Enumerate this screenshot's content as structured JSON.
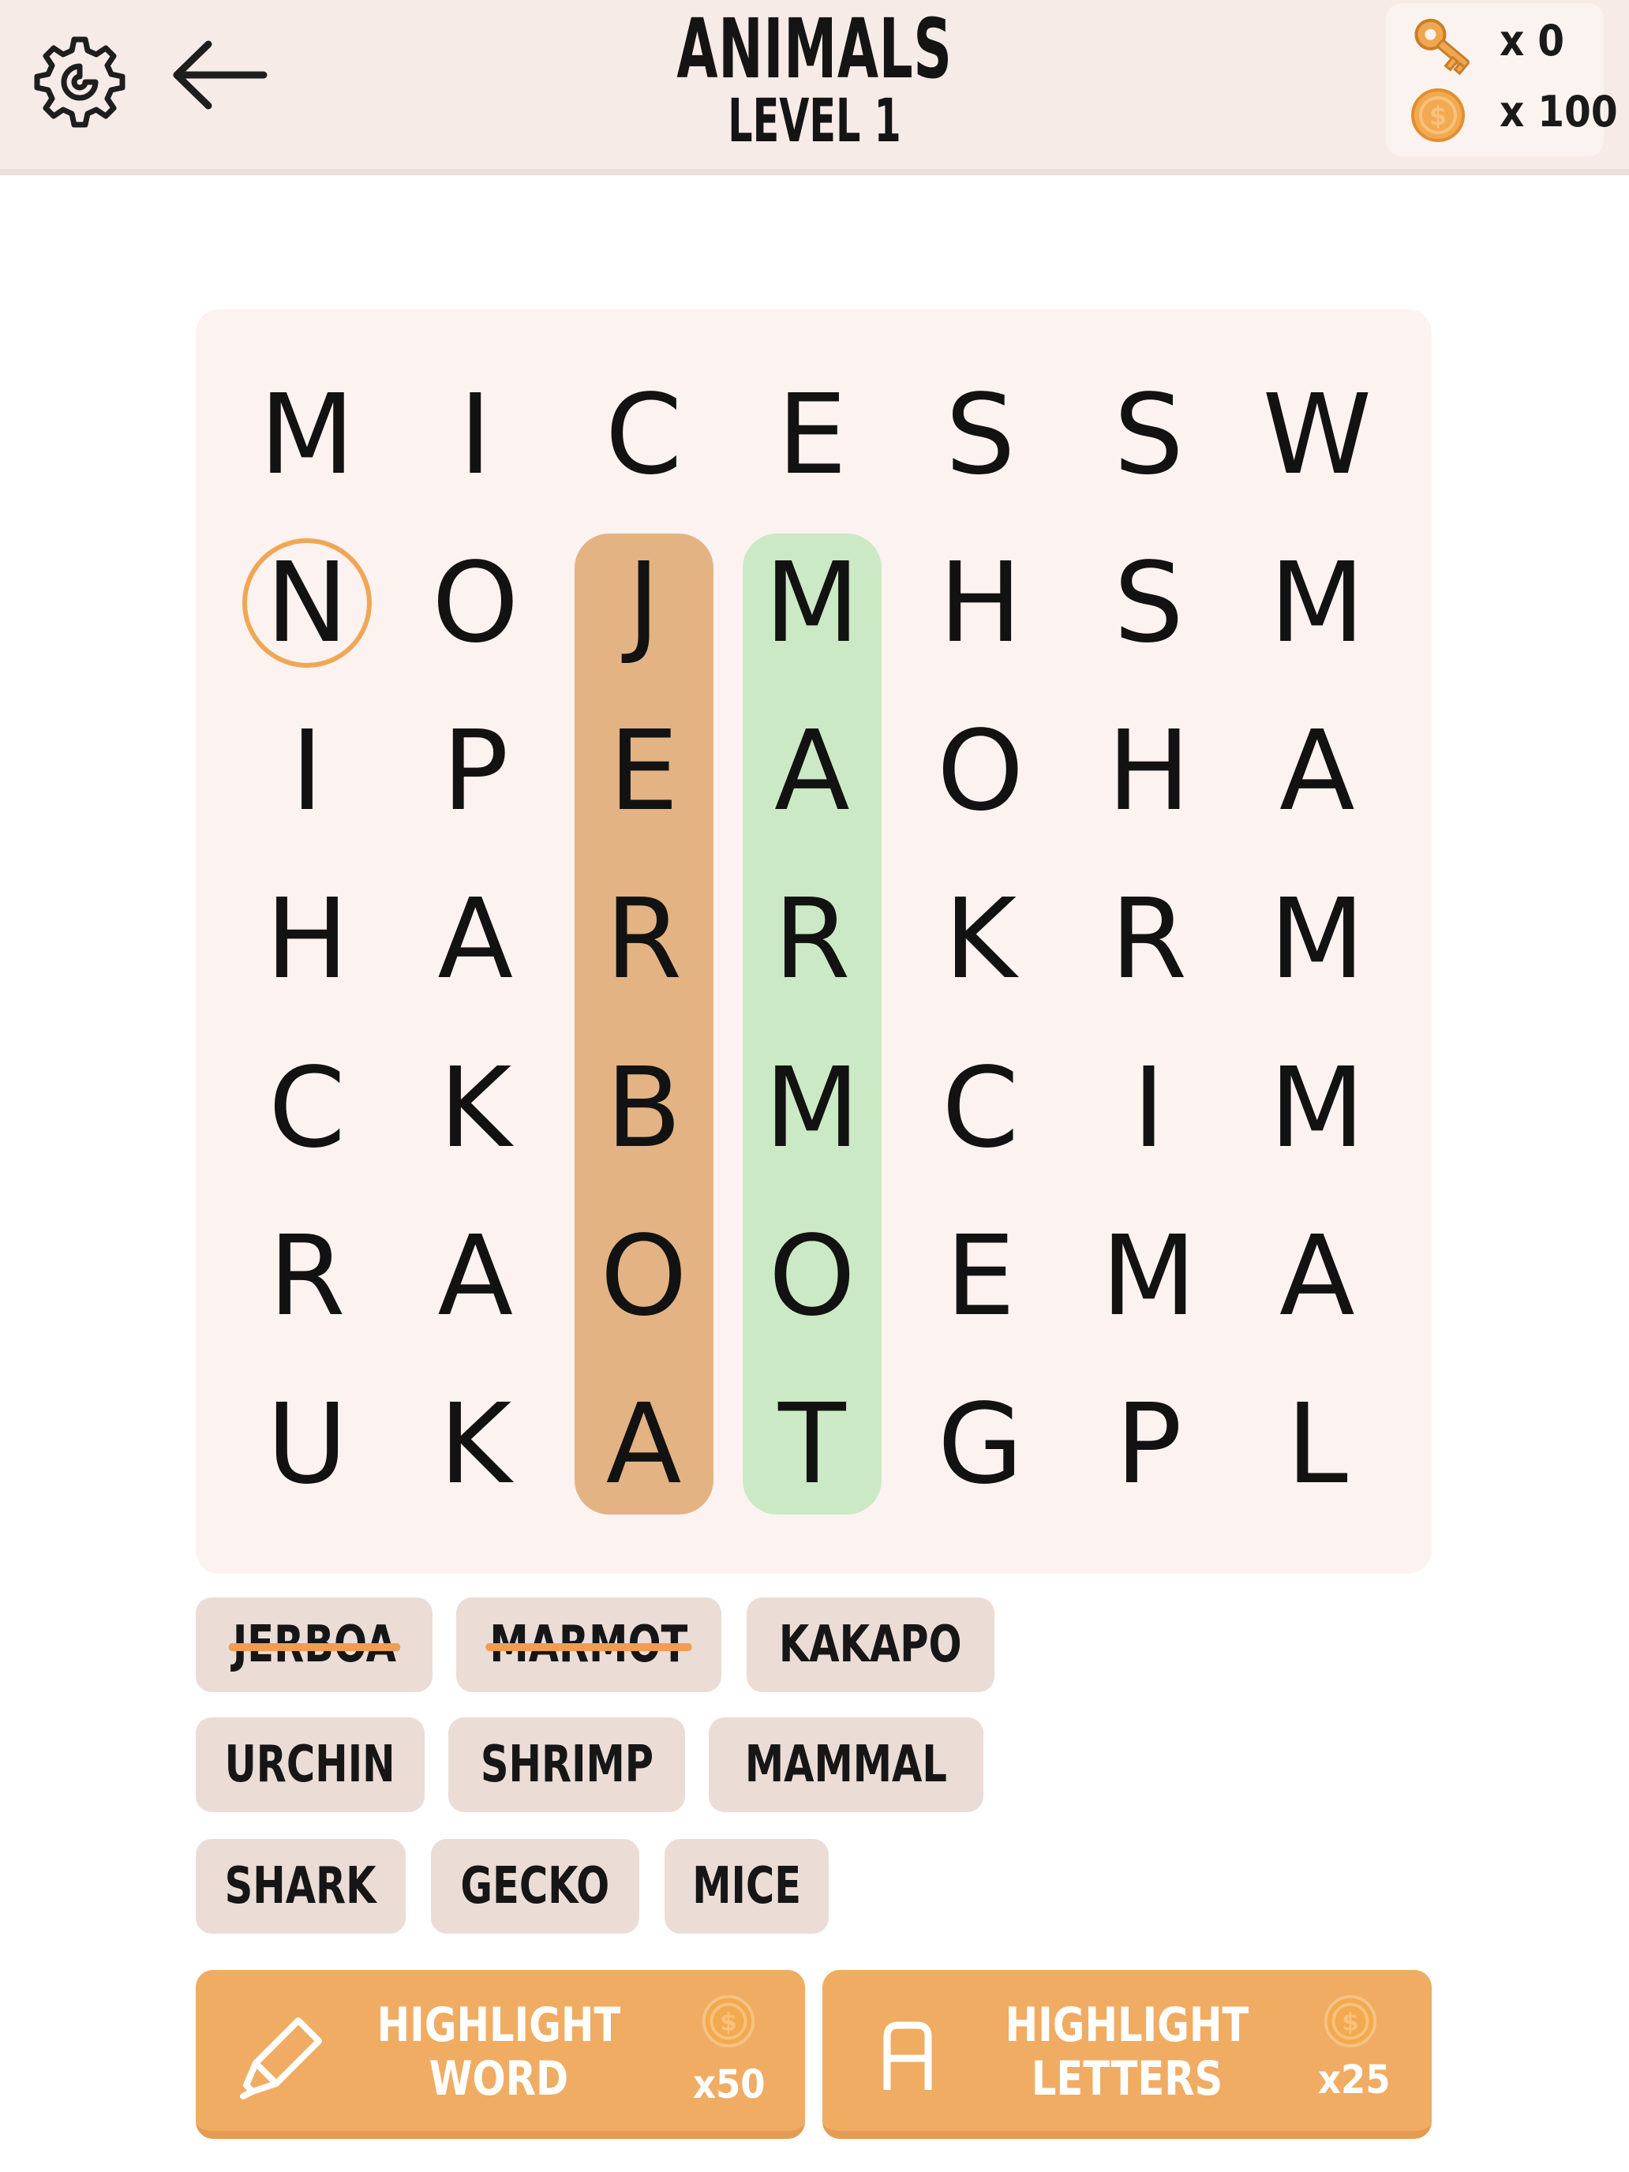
{
  "header": {
    "title": "ANIMALS",
    "level": "LEVEL 1",
    "settings_icon": "gear-icon",
    "back_icon": "back-arrow-icon",
    "keys_text": "x 0",
    "coins_text": "x 100"
  },
  "board": {
    "rows": [
      [
        "M",
        "I",
        "C",
        "E",
        "S",
        "S",
        "W"
      ],
      [
        "N",
        "O",
        "J",
        "M",
        "H",
        "S",
        "M"
      ],
      [
        "I",
        "P",
        "E",
        "A",
        "O",
        "H",
        "A"
      ],
      [
        "H",
        "A",
        "R",
        "R",
        "K",
        "R",
        "M"
      ],
      [
        "C",
        "K",
        "B",
        "M",
        "C",
        "I",
        "M"
      ],
      [
        "R",
        "A",
        "O",
        "O",
        "E",
        "M",
        "A"
      ],
      [
        "U",
        "K",
        "A",
        "T",
        "G",
        "P",
        "L"
      ]
    ],
    "found_words": [
      {
        "word": "JERBOA",
        "start": [
          1,
          2
        ],
        "end": [
          6,
          2
        ],
        "color": "#e3b383"
      },
      {
        "word": "MARMOT",
        "start": [
          1,
          3
        ],
        "end": [
          6,
          3
        ],
        "color": "#cbe9c4"
      }
    ],
    "selected_cell": [
      1,
      0
    ],
    "selection_color": "#f0a755"
  },
  "words": [
    {
      "label": "JERBOA",
      "found": true
    },
    {
      "label": "MARMOT",
      "found": true
    },
    {
      "label": "KAKAPO",
      "found": false
    },
    {
      "label": "URCHIN",
      "found": false
    },
    {
      "label": "SHRIMP",
      "found": false
    },
    {
      "label": "MAMMAL",
      "found": false
    },
    {
      "label": "SHARK",
      "found": false
    },
    {
      "label": "GECKO",
      "found": false
    },
    {
      "label": "MICE",
      "found": false
    }
  ],
  "buttons": {
    "highlight_word": {
      "line1": "HIGHLIGHT",
      "line2": "WORD",
      "cost": "x50",
      "icon": "highlighter-pen-icon"
    },
    "highlight_letters": {
      "line1": "HIGHLIGHT",
      "line2": "LETTERS",
      "cost": "x25",
      "icon": "letter-a-icon"
    }
  },
  "colors": {
    "header_bg": "#f6ebe7",
    "board_bg": "#fcf2f0",
    "chip_bg": "#ebdcd6",
    "button_bg": "#f0ac63",
    "coin": "#f3a94f"
  }
}
